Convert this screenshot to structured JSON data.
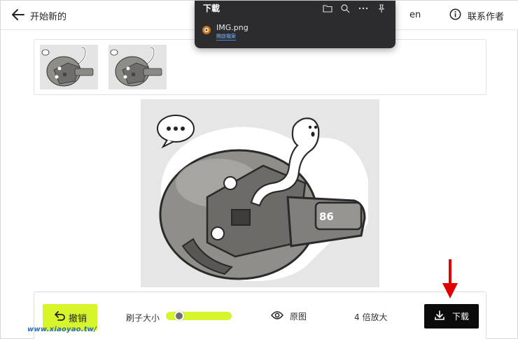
{
  "header": {
    "start_new_label": "开始新的",
    "language": "en",
    "contact_label": "联系作者"
  },
  "thumbnails": [
    {
      "icon": "robot-sticker-thumbnail"
    },
    {
      "icon": "robot-sticker-thumbnail"
    }
  ],
  "toolbar": {
    "undo_label": "撤销",
    "brush_size_label": "刷子大小",
    "brush_size_level": 0.2,
    "original_label": "原图",
    "upscale_label": "4 倍放大",
    "download_label": "下载"
  },
  "downloads_popup": {
    "title": "下載",
    "file_name": "IMG.png",
    "open_file_label": "開啟檔案"
  },
  "image": {
    "badge_number": "86"
  },
  "watermark": {
    "text": "www.xiaoyao.tw/"
  },
  "colors": {
    "accent": "#d7f52a",
    "download_button": "#0b0b0b",
    "popup_bg": "#2c2c2e",
    "annotation_arrow": "#e00000"
  }
}
